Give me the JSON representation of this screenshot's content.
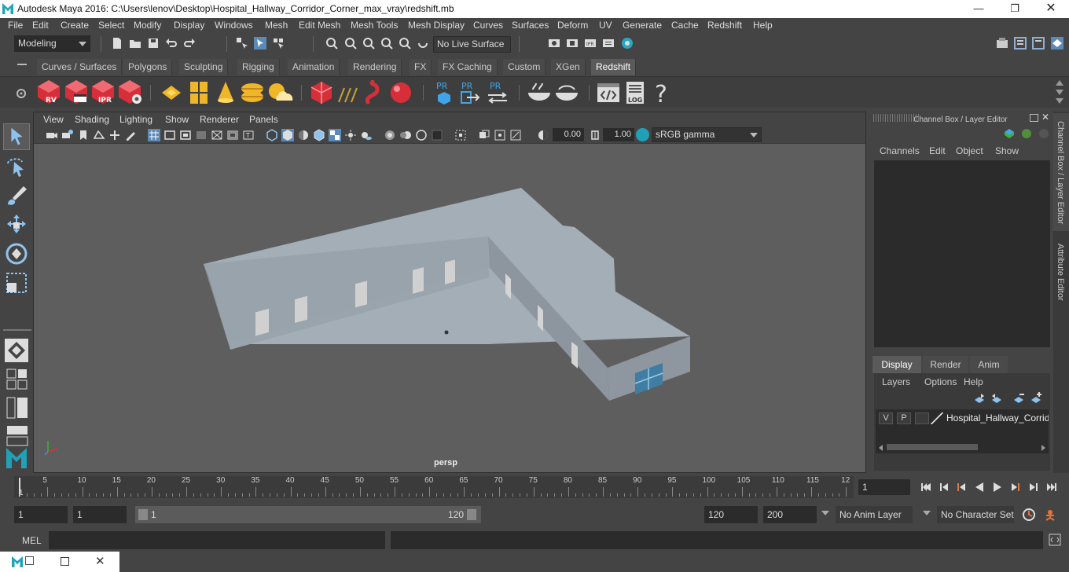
{
  "window": {
    "title": "Autodesk Maya 2016: C:\\Users\\lenov\\Desktop\\Hospital_Hallway_Corridor_Corner_max_vray\\redshift.mb"
  },
  "menus": [
    "File",
    "Edit",
    "Create",
    "Select",
    "Modify",
    "Display",
    "Windows",
    "Mesh",
    "Edit Mesh",
    "Mesh Tools",
    "Mesh Display",
    "Curves",
    "Surfaces",
    "Deform",
    "UV",
    "Generate",
    "Cache",
    "Redshift",
    "Help"
  ],
  "status": {
    "mode": "Modeling",
    "live_surface": "No Live Surface"
  },
  "shelf_tabs": [
    "Curves / Surfaces",
    "Polygons",
    "Sculpting",
    "Rigging",
    "Animation",
    "Rendering",
    "FX",
    "FX Caching",
    "Custom",
    "XGen",
    "Redshift"
  ],
  "shelf_active": "Redshift",
  "shelf_icons": {
    "rv": "RV",
    "ipr": "IPR",
    "pr": "PR",
    "log": "LOG",
    "help": "?"
  },
  "viewport": {
    "menus": [
      "View",
      "Shading",
      "Lighting",
      "Show",
      "Renderer",
      "Panels"
    ],
    "exposure": "0.00",
    "gamma": "1.00",
    "color_space": "sRGB gamma",
    "camera": "persp"
  },
  "channel_box": {
    "title": "Channel Box / Layer Editor",
    "menus": [
      "Channels",
      "Edit",
      "Object",
      "Show"
    ]
  },
  "layer_editor": {
    "tabs": [
      "Display",
      "Render",
      "Anim"
    ],
    "active_tab": "Display",
    "menus": [
      "Layers",
      "Options",
      "Help"
    ],
    "layer": {
      "v": "V",
      "p": "P",
      "name": "Hospital_Hallway_Corrid"
    }
  },
  "side_tabs": {
    "channel": "Channel Box / Layer Editor",
    "attribute": "Attribute Editor"
  },
  "timeline": {
    "ticks": [
      "5",
      "10",
      "15",
      "20",
      "25",
      "30",
      "35",
      "40",
      "45",
      "50",
      "55",
      "60",
      "65",
      "70",
      "75",
      "80",
      "85",
      "90",
      "95",
      "100",
      "105",
      "110",
      "115",
      "12"
    ],
    "start_marker": "1",
    "current_frame": "1"
  },
  "range": {
    "start": "1",
    "playback_start": "1",
    "slider_start": "1",
    "slider_end": "120",
    "playback_end": "120",
    "end": "200",
    "anim_layer": "No Anim Layer",
    "char_set": "No Character Set"
  },
  "cmd": {
    "label": "MEL"
  },
  "colors": {
    "accent": "#21a1b8",
    "bg": "#444444",
    "viewport": "#5e5e5e",
    "building": "#a3aeb7"
  }
}
